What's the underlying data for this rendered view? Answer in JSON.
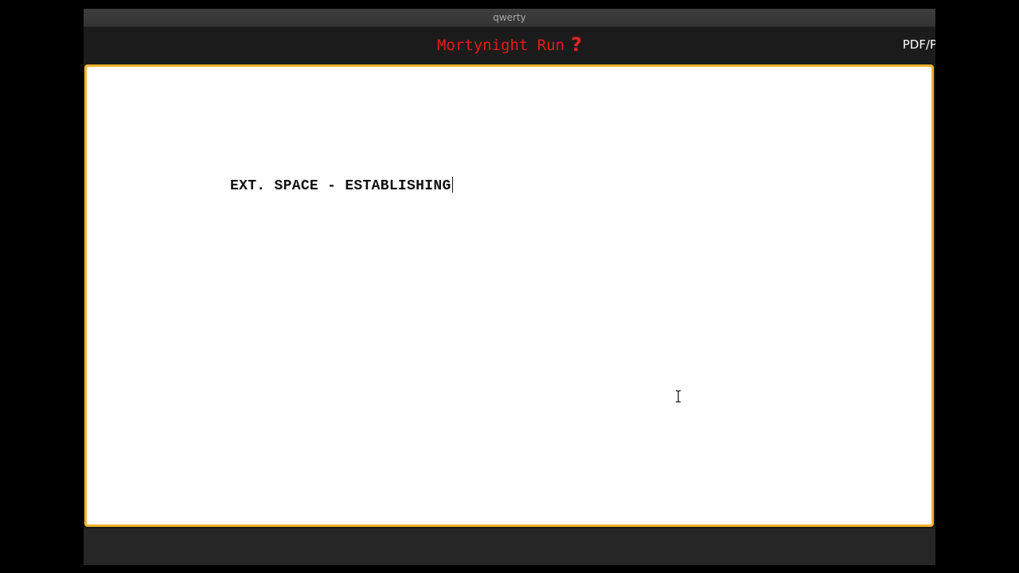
{
  "window": {
    "title": "qwerty"
  },
  "header": {
    "doc_title": "Mortynight Run",
    "help_icon": "question-mark-icon",
    "pdf_link": "PDF/Pr",
    "accent_color": "#e31b1b"
  },
  "editor": {
    "border_color": "#f4b32a",
    "lines": [
      "EXT. SPACE - ESTABLISHING"
    ]
  }
}
